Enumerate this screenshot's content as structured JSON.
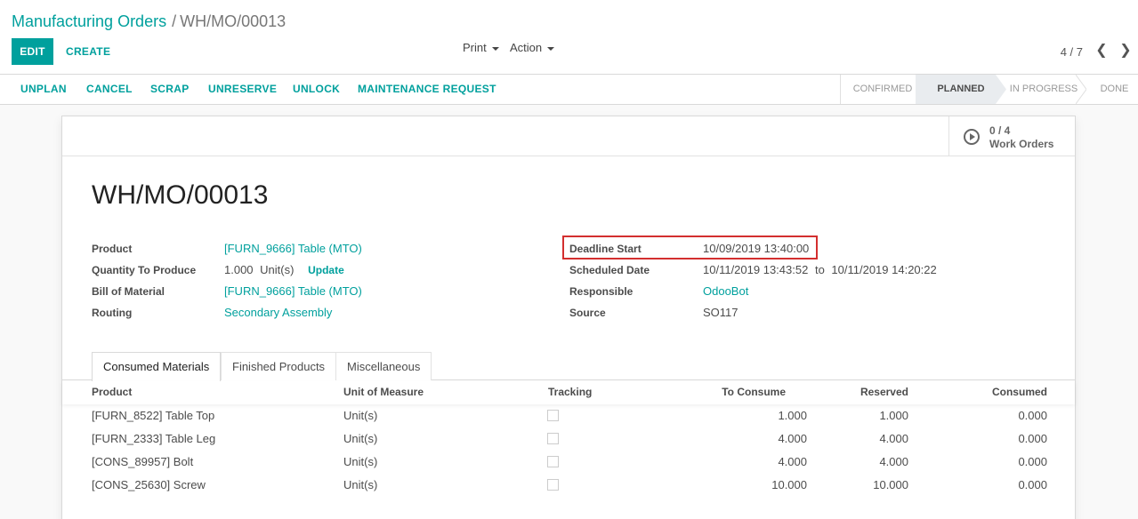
{
  "breadcrumb": {
    "parent": "Manufacturing Orders",
    "separator": "/",
    "current": "WH/MO/00013"
  },
  "toolbar": {
    "edit_label": "EDIT",
    "create_label": "CREATE",
    "print_label": "Print",
    "action_label": "Action"
  },
  "pager": {
    "value": "4 / 7",
    "prev_icon": "chevron-left-icon",
    "next_icon": "chevron-right-icon",
    "prev_glyph": "❮",
    "next_glyph": "❯"
  },
  "header_buttons": [
    "UNPLAN",
    "CANCEL",
    "SCRAP",
    "UNRESERVE",
    "UNLOCK",
    "MAINTENANCE REQUEST"
  ],
  "stages": [
    {
      "label": "CONFIRMED",
      "active": false
    },
    {
      "label": "PLANNED",
      "active": true
    },
    {
      "label": "IN PROGRESS",
      "active": false
    },
    {
      "label": "DONE",
      "active": false
    }
  ],
  "smart_button": {
    "icon": "play-circle-icon",
    "value": "0 / 4",
    "label": "Work Orders"
  },
  "record": {
    "title": "WH/MO/00013",
    "left_fields": [
      {
        "label": "Product",
        "value": "[FURN_9666] Table (MTO)",
        "link": true
      },
      {
        "label": "Quantity To Produce",
        "value": "1.000",
        "unit": "Unit(s)",
        "action": "Update"
      },
      {
        "label": "Bill of Material",
        "value": "[FURN_9666] Table (MTO)",
        "link": true
      },
      {
        "label": "Routing",
        "value": "Secondary Assembly",
        "link": true
      }
    ],
    "right_fields": [
      {
        "label": "Deadline Start",
        "value": "10/09/2019 13:40:00",
        "link": false
      },
      {
        "label": "Scheduled Date",
        "value": "10/11/2019 13:43:52",
        "to": "to",
        "value_end": "10/11/2019 14:20:22",
        "link": false
      },
      {
        "label": "Responsible",
        "value": "OdooBot",
        "link": true
      },
      {
        "label": "Source",
        "value": "SO117",
        "link": false
      }
    ]
  },
  "tabs": [
    {
      "label": "Consumed Materials",
      "active": true
    },
    {
      "label": "Finished Products",
      "active": false
    },
    {
      "label": "Miscellaneous",
      "active": false
    }
  ],
  "table": {
    "columns": [
      "Product",
      "Unit of Measure",
      "Tracking",
      "To Consume",
      "Reserved",
      "Consumed"
    ],
    "rows": [
      {
        "product": "[FURN_8522] Table Top",
        "uom": "Unit(s)",
        "to_consume": "1.000",
        "reserved": "1.000",
        "consumed": "0.000"
      },
      {
        "product": "[FURN_2333] Table Leg",
        "uom": "Unit(s)",
        "to_consume": "4.000",
        "reserved": "4.000",
        "consumed": "0.000"
      },
      {
        "product": "[CONS_89957] Bolt",
        "uom": "Unit(s)",
        "to_consume": "4.000",
        "reserved": "4.000",
        "consumed": "0.000"
      },
      {
        "product": "[CONS_25630] Screw",
        "uom": "Unit(s)",
        "to_consume": "10.000",
        "reserved": "10.000",
        "consumed": "0.000"
      }
    ]
  },
  "colors": {
    "accent": "#00a09d",
    "highlight": "#d32f2f"
  }
}
